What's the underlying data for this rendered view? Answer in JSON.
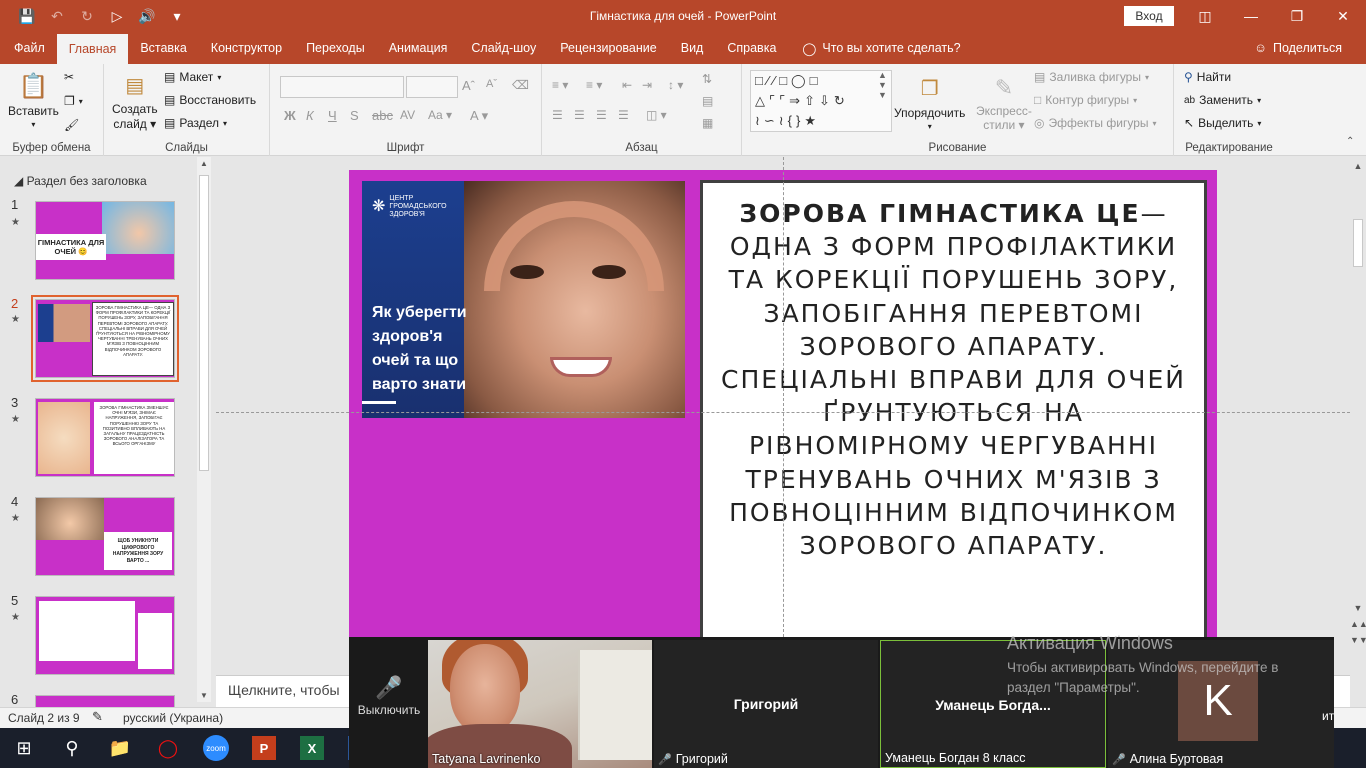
{
  "window": {
    "title": "Гімнастика для очей  -  PowerPoint",
    "login_label": "Вход"
  },
  "tabs": [
    "Файл",
    "Главная",
    "Вставка",
    "Конструктор",
    "Переходы",
    "Анимация",
    "Слайд-шоу",
    "Рецензирование",
    "Вид",
    "Справка"
  ],
  "tell_me": "Что вы хотите сделать?",
  "share_label": "Поделиться",
  "ribbon": {
    "clipboard": {
      "paste": "Вставить",
      "label": "Буфер обмена"
    },
    "slides": {
      "new_slide_1": "Создать",
      "new_slide_2": "слайд",
      "layout": "Макет",
      "reset": "Восстановить",
      "section": "Раздел",
      "label": "Слайды"
    },
    "font": {
      "label": "Шрифт"
    },
    "paragraph": {
      "label": "Абзац"
    },
    "drawing": {
      "arrange": "Упорядочить",
      "styles_1": "Экспресс-",
      "styles_2": "стили",
      "fill": "Заливка фигуры",
      "outline": "Контур фигуры",
      "effects": "Эффекты фигуры",
      "label": "Рисование"
    },
    "editing": {
      "find": "Найти",
      "replace": "Заменить",
      "select": "Выделить",
      "label": "Редактирование"
    }
  },
  "left_panel": {
    "section_title": "Раздел без заголовка",
    "slides": [
      {
        "num": "1",
        "caption": "ГІМНАСТИКА ДЛЯ ОЧЕЙ 😊"
      },
      {
        "num": "2",
        "caption": "ЗОРОВА ГІМНАСТИКА ЦЕ— ОДНА З ФОРМ ПРОФІЛАКТИКИ ТА КОРЕКЦІЇ ПОРУШЕНЬ ЗОРУ, ЗАПОБІГАННЯ ПЕРЕВТОМІ ЗОРОВОГО АПАРАТУ. СПЕЦІАЛЬНІ ВПРАВИ ДЛЯ ОЧЕЙ ҐРУНТУЮТЬСЯ НА РІВНОМІРНОМУ ЧЕРГУВАННІ ТРЕНУВАНЬ ОЧНИХ М'ЯЗІВ З ПОВНОЦІННИМ ВІДПОЧИНКОМ ЗОРОВОГО АПАРАТУ."
      },
      {
        "num": "3",
        "caption": "ЗОРОВА ГІМНАСТИКА ЗМЕНШУЄ ОЧНІ М'ЯЗИ, ЗНІМАЄ НАПРУЖЕННЯ, ЗАПОБІГАЄ ПОРУШЕННЮ ЗОРУ ТА ПОЗИТИВНО ВПЛИВАЮТЬ НА ЗАГАЛЬНУ ПРАЦЕЗДАТНІСТЬ ЗОРОВОГО АНАЛІЗАТОРА ТА ВСЬОГО ОРГАНІЗМУ"
      },
      {
        "num": "4",
        "caption": "ЩОБ УНИКНУТИ ЦИФРОВОГО НАПРУЖЕННЯ ЗОРУ ВАРТО ..."
      },
      {
        "num": "5",
        "caption": ""
      },
      {
        "num": "6",
        "caption": ""
      }
    ]
  },
  "slide": {
    "image_text": "Як уберегти здоров'я очей та що варто знати",
    "logo_text": "ЦЕНТР ГРОМАДСЬКОГО ЗДОРОВ'Я",
    "text_bold": "ЗОРОВА ГІМНАСТИКА ЦЕ",
    "text_rest": "— ОДНА З ФОРМ ПРОФІЛАКТИКИ ТА КОРЕКЦІЇ ПОРУШЕНЬ ЗОРУ, ЗАПОБІГАННЯ ПЕРЕВТОМІ ЗОРОВОГО АПАРАТУ. СПЕЦІАЛЬНІ ВПРАВИ ДЛЯ ОЧЕЙ ҐРУНТУЮТЬСЯ НА РІВНОМІРНОМУ ЧЕРГУВАННІ ТРЕНУВАНЬ ОЧНИХ М'ЯЗІВ З ПОВНОЦІННИМ ВІДПОЧИНКОМ ЗОРОВОГО АПАРАТУ."
  },
  "notes_placeholder": "Щелкните, чтобы",
  "status": {
    "slide": "Слайд 2 из 9",
    "language": "русский (Украина)"
  },
  "zoom": {
    "mute_label": "Выключить",
    "participants": [
      {
        "video_name": "Tatyana Lavrinenko"
      },
      {
        "tile_name": "Григорий",
        "footer": "Григорий"
      },
      {
        "tile_name": "Уманець  Богда...",
        "footer": "Уманець Богдан 8 класс"
      },
      {
        "tile_name": "K",
        "footer": "Алина Буртовая"
      }
    ],
    "tail": "ит"
  },
  "activation": {
    "title": "Активация Windows",
    "text_1": "Чтобы активировать Windows, перейдите в",
    "text_2": "раздел \"Параметры\"."
  },
  "colors": {
    "accent": "#b7472a",
    "slide_bg": "#c830c8"
  }
}
